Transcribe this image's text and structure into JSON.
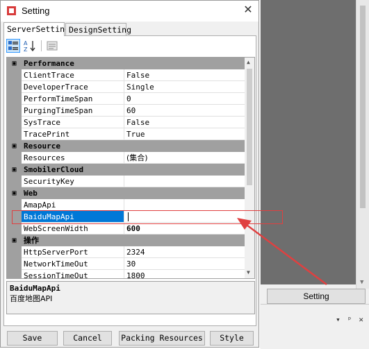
{
  "window": {
    "title": "Setting"
  },
  "tabs": [
    {
      "label": "ServerSetting"
    },
    {
      "label": "DesignSetting"
    }
  ],
  "toolbar": {
    "categorized_icon": "categorized-icon",
    "alphabetical_icon": "sort-alpha-icon",
    "property_pages_icon": "property-pages-icon"
  },
  "grid": {
    "categories": [
      {
        "label": "Performance",
        "rows": [
          {
            "name": "ClientTrace",
            "value": "False"
          },
          {
            "name": "DeveloperTrace",
            "value": "Single"
          },
          {
            "name": "PerformTimeSpan",
            "value": "0"
          },
          {
            "name": "PurgingTimeSpan",
            "value": "60"
          },
          {
            "name": "SysTrace",
            "value": "False"
          },
          {
            "name": "TracePrint",
            "value": "True"
          }
        ]
      },
      {
        "label": "Resource",
        "rows": [
          {
            "name": "Resources",
            "value": "(集合)"
          }
        ]
      },
      {
        "label": "SmobilerCloud",
        "rows": [
          {
            "name": "SecurityKey",
            "value": ""
          }
        ]
      },
      {
        "label": "Web",
        "rows": [
          {
            "name": "AmapApi",
            "value": ""
          },
          {
            "name": "BaiduMapApi",
            "value": ""
          },
          {
            "name": "WebScreenWidth",
            "value": "600"
          }
        ]
      },
      {
        "label": "操作",
        "rows": [
          {
            "name": "HttpServerPort",
            "value": "2324"
          },
          {
            "name": "NetworkTimeOut",
            "value": "30"
          },
          {
            "name": "SessionTimeOut",
            "value": "1800"
          }
        ]
      }
    ]
  },
  "description": {
    "title": "BaiduMapApi",
    "text": "百度地图API"
  },
  "buttons": {
    "save": "Save",
    "cancel": "Cancel",
    "packing": "Packing Resources",
    "style": "Style"
  },
  "ide": {
    "setting_button": "Setting",
    "pane_icons": [
      "▾",
      "ᵖ",
      "✕"
    ]
  },
  "colors": {
    "selection": "#0078d7",
    "annotation": "#e04040",
    "category_bg": "#a0a0a0"
  }
}
